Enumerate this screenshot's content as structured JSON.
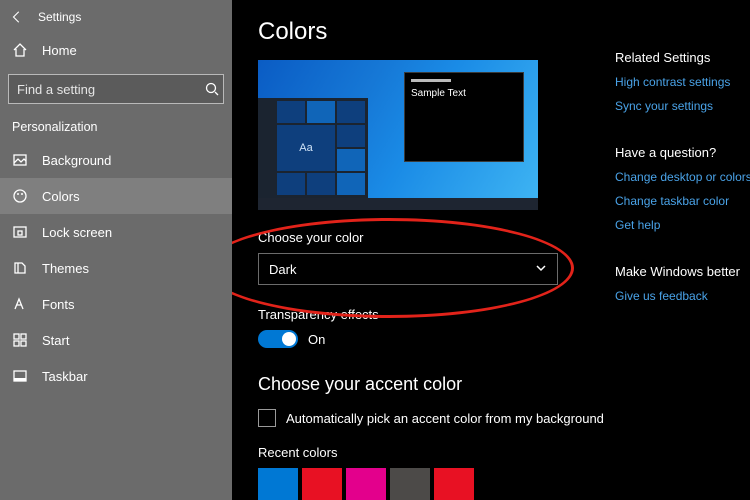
{
  "window": {
    "app": "Settings"
  },
  "sidebar": {
    "home": "Home",
    "search_placeholder": "Find a setting",
    "section": "Personalization",
    "items": [
      {
        "label": "Background"
      },
      {
        "label": "Colors"
      },
      {
        "label": "Lock screen"
      },
      {
        "label": "Themes"
      },
      {
        "label": "Fonts"
      },
      {
        "label": "Start"
      },
      {
        "label": "Taskbar"
      }
    ]
  },
  "page": {
    "title": "Colors",
    "preview": {
      "sample_text": "Sample Text",
      "tile_text": "Aa"
    },
    "choose_color": {
      "label": "Choose your color",
      "value": "Dark"
    },
    "transparency": {
      "label": "Transparency effects",
      "value": "On"
    },
    "accent": {
      "heading": "Choose your accent color",
      "auto_label": "Automatically pick an accent color from my background",
      "recent_label": "Recent colors",
      "recent": [
        "#0078d4",
        "#e81123",
        "#e3008c",
        "#4c4a48",
        "#e81123"
      ]
    }
  },
  "right": {
    "related_head": "Related Settings",
    "related": [
      "High contrast settings",
      "Sync your settings"
    ],
    "question_head": "Have a question?",
    "question": [
      "Change desktop or colors",
      "Change taskbar color",
      "Get help"
    ],
    "better_head": "Make Windows better",
    "better": [
      "Give us feedback"
    ]
  }
}
